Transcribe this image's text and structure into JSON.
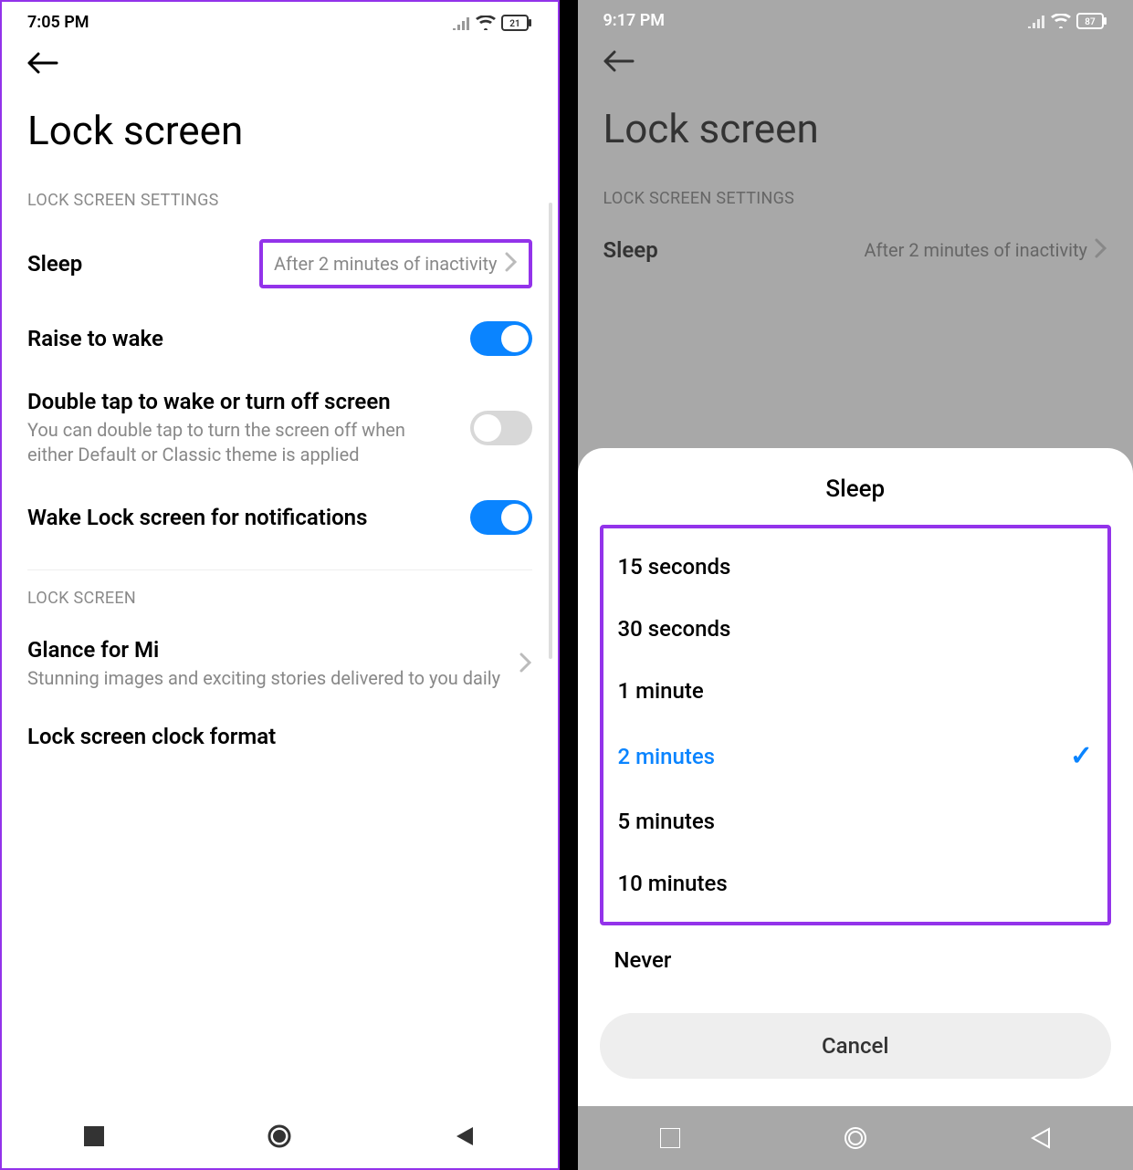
{
  "left": {
    "status": {
      "time": "7:05 PM",
      "battery": "21"
    },
    "title": "Lock screen",
    "section1": "LOCK SCREEN SETTINGS",
    "sleep": {
      "label": "Sleep",
      "value": "After 2 minutes of inactivity"
    },
    "raise": {
      "label": "Raise to wake",
      "on": true
    },
    "doubletap": {
      "label": "Double tap to wake or turn off screen",
      "desc": "You can double tap to turn the screen off when either Default or Classic theme is applied",
      "on": false
    },
    "wakelock": {
      "label": "Wake Lock screen for notifications",
      "on": true
    },
    "section2": "LOCK SCREEN",
    "glance": {
      "label": "Glance for Mi",
      "desc": "Stunning images and exciting stories delivered to you daily"
    },
    "clockformat": {
      "label": "Lock screen clock format"
    }
  },
  "right": {
    "status": {
      "time": "9:17 PM",
      "battery": "87"
    },
    "title": "Lock screen",
    "section1": "LOCK SCREEN SETTINGS",
    "sleep": {
      "label": "Sleep",
      "value": "After 2 minutes of inactivity"
    },
    "sheet": {
      "title": "Sleep",
      "options": {
        "o0": "15 seconds",
        "o1": "30 seconds",
        "o2": "1 minute",
        "o3": "2 minutes",
        "o4": "5 minutes",
        "o5": "10 minutes"
      },
      "extra": "Never",
      "cancel": "Cancel",
      "selectedIndex": 3
    }
  }
}
